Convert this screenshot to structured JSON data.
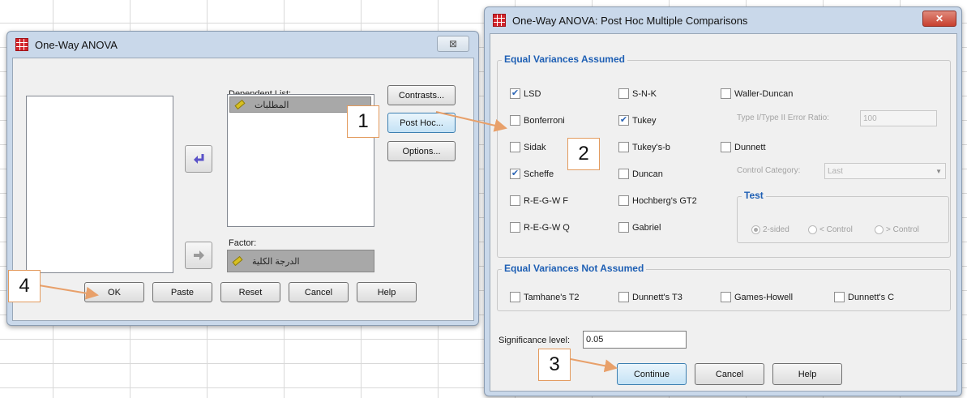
{
  "anova": {
    "title": "One-Way ANOVA",
    "dependent_label": "Dependent List:",
    "dependent_item": "المطلبات",
    "factor_label": "Factor:",
    "factor_item": "الدرجة الكلية",
    "buttons": {
      "contrasts": "Contrasts...",
      "post_hoc": "Post Hoc...",
      "options": "Options...",
      "ok": "OK",
      "paste": "Paste",
      "reset": "Reset",
      "cancel": "Cancel",
      "help": "Help"
    },
    "close_glyph": "⊠"
  },
  "posthoc": {
    "title": "One-Way ANOVA: Post Hoc Multiple Comparisons",
    "close_glyph": "✕",
    "equal_assumed_label": "Equal Variances Assumed",
    "col1": [
      {
        "label": "LSD",
        "checked": true
      },
      {
        "label": "Bonferroni",
        "checked": false
      },
      {
        "label": "Sidak",
        "checked": false
      },
      {
        "label": "Scheffe",
        "checked": true
      },
      {
        "label": "R-E-G-W F",
        "checked": false
      },
      {
        "label": "R-E-G-W Q",
        "checked": false
      }
    ],
    "col2": [
      {
        "label": "S-N-K",
        "checked": false
      },
      {
        "label": "Tukey",
        "checked": true
      },
      {
        "label": "Tukey's-b",
        "checked": false
      },
      {
        "label": "Duncan",
        "checked": false
      },
      {
        "label": "Hochberg's GT2",
        "checked": false
      },
      {
        "label": "Gabriel",
        "checked": false
      }
    ],
    "waller_duncan": "Waller-Duncan",
    "type_ratio_label": "Type I/Type II Error Ratio:",
    "type_ratio_value": "100",
    "dunnett": "Dunnett",
    "control_category_label": "Control Category:",
    "control_category_value": "Last",
    "test_label": "Test",
    "radios": [
      "2-sided",
      "< Control",
      "> Control"
    ],
    "not_assumed_label": "Equal Variances Not Assumed",
    "not_assumed": [
      "Tamhane's T2",
      "Dunnett's T3",
      "Games-Howell",
      "Dunnett's C"
    ],
    "significance_label": "Significance level:",
    "significance_value": "0.05",
    "buttons": {
      "continue": "Continue",
      "cancel": "Cancel",
      "help": "Help"
    }
  },
  "callouts": [
    "1",
    "2",
    "3",
    "4"
  ],
  "colors": {
    "callout_border": "#e39b5e",
    "arrow": "#e8a06a",
    "group_label": "#1e5fb4",
    "close_red": "#c8402f"
  }
}
